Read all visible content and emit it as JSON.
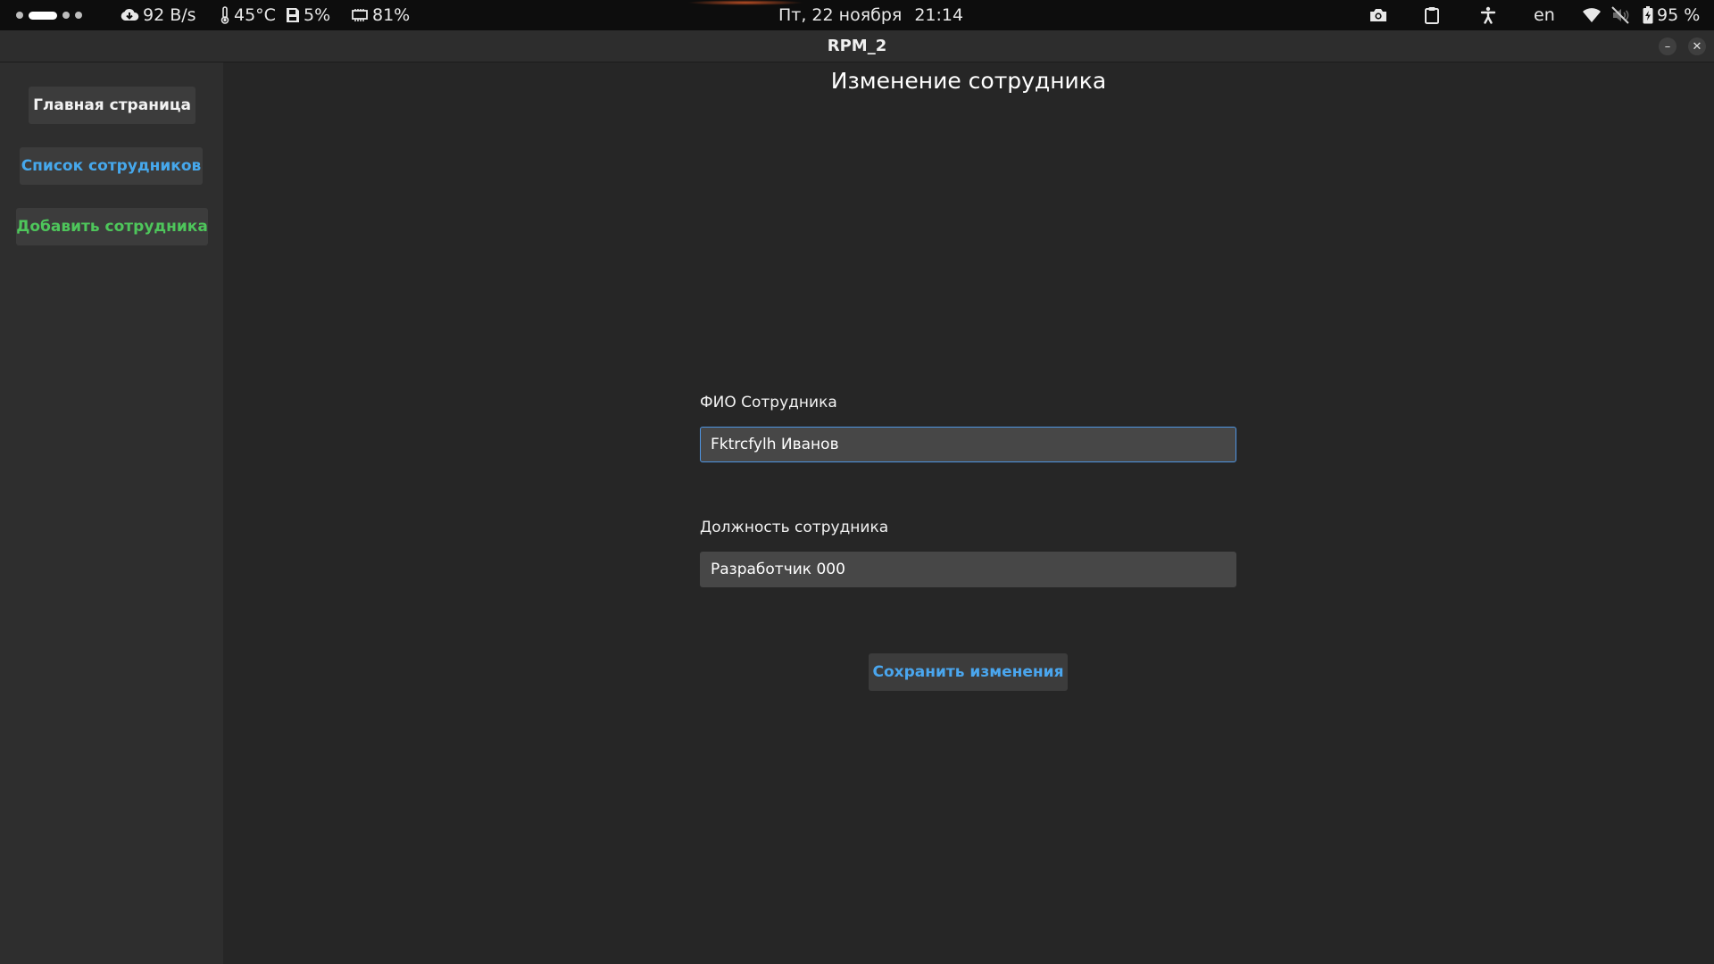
{
  "system_bar": {
    "network_speed": "92 B/s",
    "temperature": "45°C",
    "disk_usage": "5%",
    "memory_usage": "81%",
    "date": "Пт, 22 ноября",
    "time": "21:14",
    "keyboard_layout": "en",
    "battery": "95 %",
    "icons": [
      "cloud-download-icon",
      "thermometer-icon",
      "disk-icon",
      "memory-icon",
      "camera-icon",
      "clipboard-icon",
      "accessibility-icon",
      "wifi-icon",
      "volume-muted-icon",
      "battery-charging-icon"
    ]
  },
  "window": {
    "title": "RPM_2",
    "minimize_label": "–",
    "close_label": "✕"
  },
  "sidebar": {
    "items": [
      {
        "label": "Главная страница",
        "color": "#f2f2f2"
      },
      {
        "label": "Список сотрудников",
        "color": "#46a8ec"
      },
      {
        "label": "Добавить сотрудника",
        "color": "#4ec65b"
      }
    ]
  },
  "main": {
    "title": "Изменение сотрудника",
    "name_label": "ФИО Сотрудника",
    "name_value": "Fktrcfylh Иванов",
    "position_label": "Должность сотрудника",
    "position_value": "Разработчик 000",
    "save_label": "Сохранить изменения"
  },
  "colors": {
    "background": "#262626",
    "sidebar": "#2e2e2e",
    "accent_blue": "#4aa6ee",
    "accent_green": "#4ec65b",
    "focus_border": "#4f95e3"
  }
}
